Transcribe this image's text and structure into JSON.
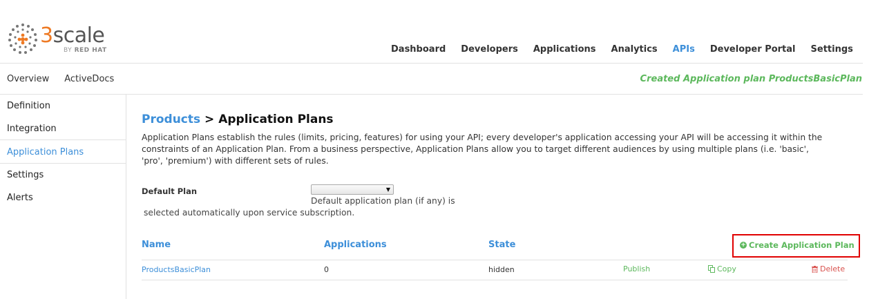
{
  "brand": {
    "logo_number": "3",
    "logo_word": "scale",
    "logo_sub_prefix": "BY",
    "logo_sub_brand": "RED HAT",
    "accent_color": "#ee7a24"
  },
  "topnav": {
    "items": [
      {
        "label": "Dashboard"
      },
      {
        "label": "Developers"
      },
      {
        "label": "Applications"
      },
      {
        "label": "Analytics"
      },
      {
        "label": "APIs"
      },
      {
        "label": "Developer Portal"
      },
      {
        "label": "Settings"
      }
    ],
    "active": "APIs"
  },
  "subnav": {
    "overview": "Overview",
    "activedocs": "ActiveDocs"
  },
  "flash": "Created Application plan ProductsBasicPlan",
  "sidebar": {
    "items": [
      {
        "label": "Definition"
      },
      {
        "label": "Integration"
      },
      {
        "label": "Application Plans"
      },
      {
        "label": "Settings"
      },
      {
        "label": "Alerts"
      }
    ],
    "active": "Application Plans"
  },
  "main": {
    "breadcrumb": "Products",
    "separator": " > ",
    "title": "Application Plans",
    "description": "Application Plans establish the rules (limits, pricing, features) for using your API; every developer's application accessing your API will be accessing it within the constraints of an Application Plan. From a business perspective, Application Plans allow you to target different audiences by using multiple plans (i.e. 'basic', 'pro', 'premium') with different sets of rules.",
    "default_plan": {
      "label": "Default Plan",
      "selected": "",
      "hint_line1": "Default application plan (if any) is",
      "hint_line2": "selected automatically upon service subscription."
    },
    "table": {
      "headers": {
        "name": "Name",
        "applications": "Applications",
        "state": "State"
      },
      "create_label": "Create Application Plan",
      "rows": [
        {
          "name": "ProductsBasicPlan",
          "applications": "0",
          "state": "hidden",
          "publish": "Publish",
          "copy": "Copy",
          "delete": "Delete"
        }
      ]
    }
  },
  "colors": {
    "link": "#3d8fd9",
    "success": "#5cb85c",
    "danger": "#d9534f",
    "highlight_border": "#e00000"
  }
}
